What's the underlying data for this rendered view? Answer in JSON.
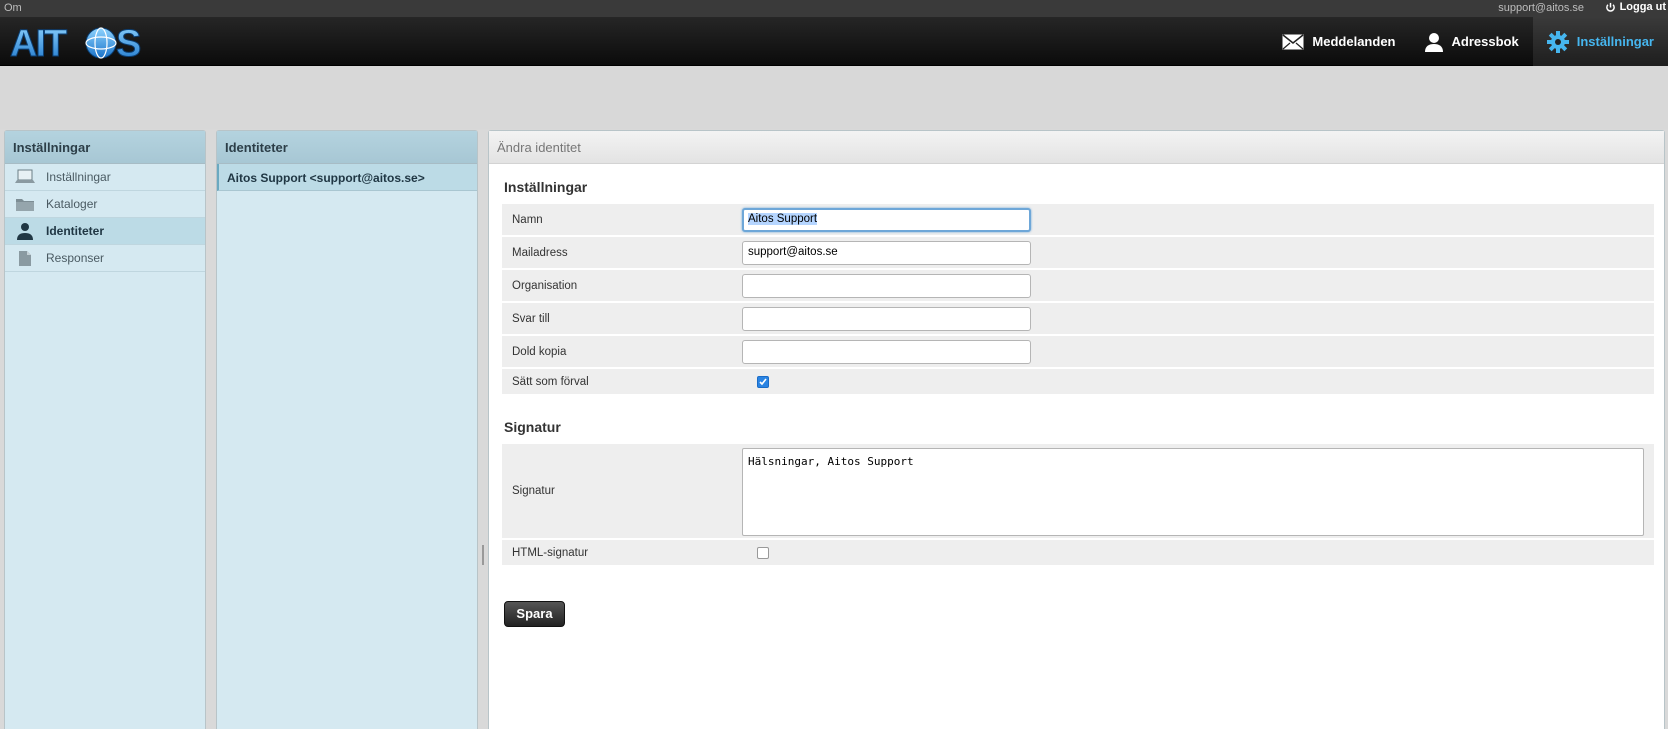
{
  "topbar": {
    "about": "Om",
    "user_email": "support@aitos.se",
    "logout": "Logga ut"
  },
  "logo": {
    "text": "AITOS"
  },
  "nav": [
    {
      "label": "Meddelanden",
      "icon": "envelope-icon",
      "active": false
    },
    {
      "label": "Adressbok",
      "icon": "person-icon",
      "active": false
    },
    {
      "label": "Inställningar",
      "icon": "gear-icon",
      "active": true
    }
  ],
  "settings_panel": {
    "title": "Inställningar",
    "items": [
      {
        "label": "Inställningar",
        "icon": "laptop-icon"
      },
      {
        "label": "Kataloger",
        "icon": "folder-icon"
      },
      {
        "label": "Identiteter",
        "icon": "person-icon",
        "selected": true
      },
      {
        "label": "Responser",
        "icon": "document-icon"
      }
    ]
  },
  "identities_panel": {
    "title": "Identiteter",
    "items": [
      "Aitos Support <support@aitos.se>"
    ]
  },
  "edit_panel": {
    "title": "Ändra identitet",
    "section_settings": "Inställningar",
    "fields": [
      {
        "label": "Namn",
        "value": "Aitos Support"
      },
      {
        "label": "Mailadress",
        "value": "support@aitos.se"
      },
      {
        "label": "Organisation",
        "value": ""
      },
      {
        "label": "Svar till",
        "value": ""
      },
      {
        "label": "Dold kopia",
        "value": ""
      }
    ],
    "default_label": "Sätt som förval",
    "default_checked": true,
    "section_signature": "Signatur",
    "signature_label": "Signatur",
    "signature_value": "Hälsningar, Aitos Support",
    "html_signature_label": "HTML-signatur",
    "html_signature_checked": false,
    "save_label": "Spara"
  },
  "colors": {
    "accent": "#46b6ef",
    "panel_bg": "#d5e9f1",
    "panel_head": "#a7c7d4",
    "checkbox_on": "#2a84e3"
  }
}
